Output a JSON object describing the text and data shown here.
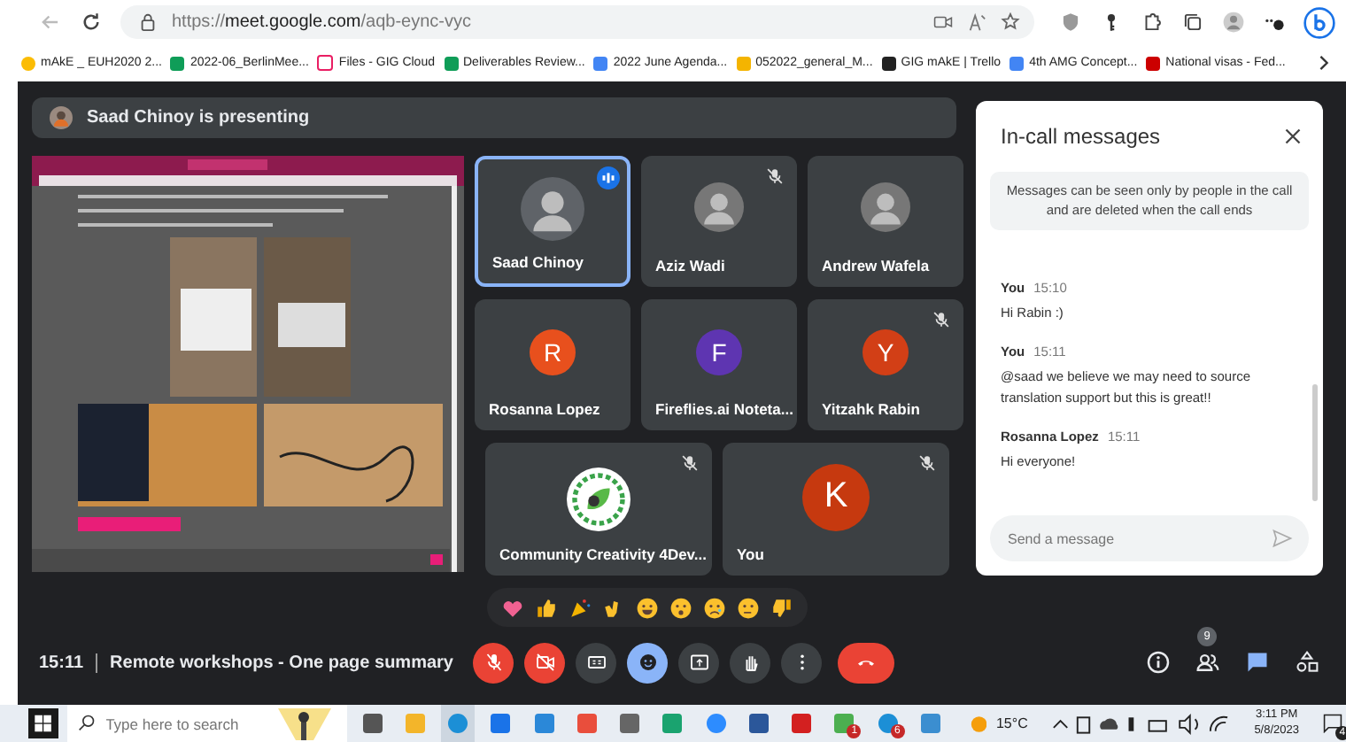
{
  "browser": {
    "url": {
      "prefix": "https://",
      "host": "meet.google.com",
      "path": "/aqb-eync-vyc"
    },
    "bookmarks": [
      {
        "kind": "drive",
        "label": "mAkE _ EUH2020 2..."
      },
      {
        "kind": "sheets",
        "label": "2022-06_BerlinMee..."
      },
      {
        "kind": "files",
        "label": "Files - GIG Cloud"
      },
      {
        "kind": "sheets",
        "label": "Deliverables Review..."
      },
      {
        "kind": "docs",
        "label": "2022 June Agenda..."
      },
      {
        "kind": "slides",
        "label": "052022_general_M..."
      },
      {
        "kind": "trello",
        "label": "GIG mAkE | Trello"
      },
      {
        "kind": "docs",
        "label": "4th AMG Concept..."
      },
      {
        "kind": "flag",
        "label": "National visas - Fed..."
      }
    ]
  },
  "presenting": {
    "text": "Saad Chinoy is presenting"
  },
  "tiles": [
    {
      "name": "Saad Chinoy",
      "kind": "photo",
      "speaking": true,
      "muted": false
    },
    {
      "name": "Aziz Wadi",
      "kind": "photo",
      "speaking": false,
      "muted": true
    },
    {
      "name": "Andrew Wafela",
      "kind": "photo",
      "speaking": false,
      "muted": false
    },
    {
      "name": "Rosanna Lopez",
      "kind": "initial",
      "initial": "R",
      "color": "#e8501d",
      "speaking": false,
      "muted": false
    },
    {
      "name": "Fireflies.ai Noteta...",
      "kind": "initial",
      "initial": "F",
      "color": "#5e35b1",
      "speaking": false,
      "muted": false
    },
    {
      "name": "Yitzahk Rabin",
      "kind": "initial",
      "initial": "Y",
      "color": "#d23f16",
      "speaking": false,
      "muted": true
    },
    {
      "name": "Community Creativity 4Dev...",
      "kind": "logo",
      "speaking": false,
      "muted": true
    },
    {
      "name": "You",
      "kind": "initial",
      "initial": "K",
      "color": "#c6390f",
      "speaking": false,
      "muted": true
    }
  ],
  "chat": {
    "title": "In-call messages",
    "notice": "Messages can be seen only by people in the call and are deleted when the call ends",
    "messages": [
      {
        "sender": "You",
        "time": "15:10",
        "text": "Hi Rabin :)"
      },
      {
        "sender": "You",
        "time": "15:11",
        "text": "@saad we believe we may need to source translation support but this is great!!"
      },
      {
        "sender": "Rosanna Lopez",
        "time": "15:11",
        "text": "Hi everyone!"
      }
    ],
    "input": {
      "placeholder": "Send a message"
    }
  },
  "meeting": {
    "time": "15:11",
    "title": "Remote workshops - One page summary"
  },
  "controls": [
    {
      "kind": "mic",
      "on": false
    },
    {
      "kind": "camera",
      "on": false
    },
    {
      "kind": "captions",
      "on": false
    },
    {
      "kind": "emoji",
      "on": true
    },
    {
      "kind": "present",
      "on": false
    },
    {
      "kind": "hand",
      "on": false
    },
    {
      "kind": "more",
      "on": false
    },
    {
      "kind": "end"
    }
  ],
  "side_controls": [
    {
      "kind": "info",
      "selected": false
    },
    {
      "kind": "people",
      "selected": false,
      "badge": "9"
    },
    {
      "kind": "chat",
      "selected": true
    },
    {
      "kind": "activities",
      "selected": false
    }
  ],
  "taskbar": {
    "search": {
      "placeholder": "Type here to search"
    },
    "apps": [
      {
        "kind": "taskview",
        "selected": false
      },
      {
        "kind": "folder",
        "selected": false
      },
      {
        "kind": "edge",
        "selected": true
      },
      {
        "kind": "mail",
        "selected": false
      },
      {
        "kind": "app",
        "selected": false
      },
      {
        "kind": "store",
        "selected": false
      },
      {
        "kind": "calculator",
        "selected": false
      },
      {
        "kind": "shield",
        "selected": false
      },
      {
        "kind": "zoom",
        "selected": false
      },
      {
        "kind": "word",
        "selected": false
      },
      {
        "kind": "acrobat",
        "selected": false
      },
      {
        "kind": "game",
        "selected": false,
        "badge": "1"
      },
      {
        "kind": "edge",
        "selected": false,
        "badge": "6"
      },
      {
        "kind": "photos",
        "selected": false
      }
    ],
    "weather": "15°C",
    "time": "3:11 PM",
    "date": "5/8/2023",
    "notifications": "4"
  }
}
